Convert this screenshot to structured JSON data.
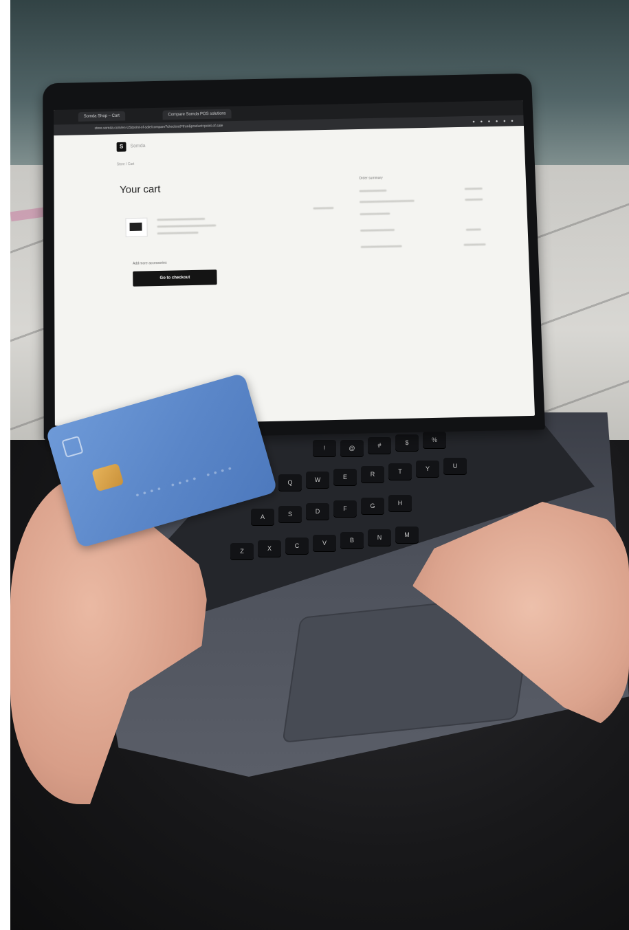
{
  "browser": {
    "tabs": [
      "Somda Shop – Cart",
      "Compare Somda POS solutions"
    ],
    "url": "store.somda.com/en-US/point-of-sale/compare?checkout=true&product=point-of-sale"
  },
  "page": {
    "site_name": "Somda",
    "breadcrumb": "Store / Cart",
    "title": "Your cart",
    "checkout_label": "Go to checkout",
    "add_link": "Add more accessories",
    "summary_title": "Order summary"
  },
  "card": {
    "color": "#5a86c8",
    "chip_color": "#d9a34c"
  },
  "colors": {
    "checkout_button": "#141414",
    "laptop_body": "#4d515b"
  }
}
